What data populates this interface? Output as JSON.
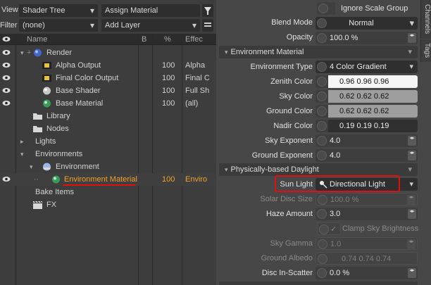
{
  "topbar": {
    "view_label": "View",
    "view_value": "Shader Tree",
    "assign_button": "Assign Material",
    "filter_label": "Filter",
    "filter_value": "(none)",
    "add_layer": "Add Layer"
  },
  "columns": {
    "name": "Name",
    "b": "B",
    "pct": "%",
    "effect": "Effec"
  },
  "tree": [
    {
      "label": "Render",
      "pct": "",
      "effect": "",
      "icon": "render-sphere-icon",
      "eye": true
    },
    {
      "label": "Alpha Output",
      "pct": "100",
      "effect": "Alpha",
      "icon": "film-output-icon",
      "eye": true
    },
    {
      "label": "Final Color Output",
      "pct": "100",
      "effect": "Final C",
      "icon": "film-output-icon",
      "eye": true
    },
    {
      "label": "Base Shader",
      "pct": "100",
      "effect": "Full Sh",
      "icon": "shader-sphere-icon",
      "eye": true
    },
    {
      "label": "Base Material",
      "pct": "100",
      "effect": "(all)",
      "icon": "material-sphere-icon",
      "eye": true
    },
    {
      "label": "Library",
      "pct": "",
      "effect": "",
      "icon": "folder-icon",
      "eye": false
    },
    {
      "label": "Nodes",
      "pct": "",
      "effect": "",
      "icon": "folder-icon",
      "eye": false
    },
    {
      "label": "Lights",
      "pct": "",
      "effect": "",
      "icon": "",
      "eye": false
    },
    {
      "label": "Environments",
      "pct": "",
      "effect": "",
      "icon": "",
      "eye": false
    },
    {
      "label": "Environment",
      "pct": "",
      "effect": "",
      "icon": "environment-icon",
      "eye": false
    },
    {
      "label": "Environment Material",
      "pct": "100",
      "effect": "Enviro",
      "icon": "material-sphere-icon",
      "eye": true
    },
    {
      "label": "Bake Items",
      "pct": "",
      "effect": "",
      "icon": "",
      "eye": false
    },
    {
      "label": "FX",
      "pct": "",
      "effect": "",
      "icon": "clapper-icon",
      "eye": false
    }
  ],
  "properties": {
    "ignore_scale": "Ignore Scale Group",
    "blend_mode_label": "Blend Mode",
    "blend_mode_value": "Normal",
    "opacity_label": "Opacity",
    "opacity_value": "100.0 %",
    "section_env": "Environment Material",
    "env_type_label": "Environment Type",
    "env_type_value": "4 Color Gradient",
    "zenith_label": "Zenith Color",
    "zenith_value": "0.96  0.96  0.96",
    "sky_label": "Sky Color",
    "sky_value": "0.62  0.62  0.62",
    "ground_label": "Ground Color",
    "ground_value": "0.62  0.62  0.62",
    "nadir_label": "Nadir Color",
    "nadir_value": "0.19  0.19  0.19",
    "sky_exp_label": "Sky Exponent",
    "sky_exp_value": "4.0",
    "ground_exp_label": "Ground Exponent",
    "ground_exp_value": "4.0",
    "section_daylight": "Physically-based Daylight",
    "sun_light_label": "Sun Light",
    "sun_light_value": "Directional Light",
    "solar_disc_label": "Solar Disc Size",
    "solar_disc_value": "100.0 %",
    "haze_label": "Haze Amount",
    "haze_value": "3.0",
    "clamp_label": "Clamp Sky Brightness",
    "sky_gamma_label": "Sky Gamma",
    "sky_gamma_value": "1.0",
    "ground_albedo_label": "Ground Albedo",
    "ground_albedo_value": "0.74  0.74  0.74",
    "disc_scatter_label": "Disc In-Scatter",
    "disc_scatter_value": "0.0 %"
  },
  "side_tabs": {
    "channels": "Channels",
    "tags": "Tags"
  },
  "colors": {
    "highlight": "#e0e0e0",
    "annotation_red": "#e01010",
    "selected_text": "#f0a030"
  }
}
